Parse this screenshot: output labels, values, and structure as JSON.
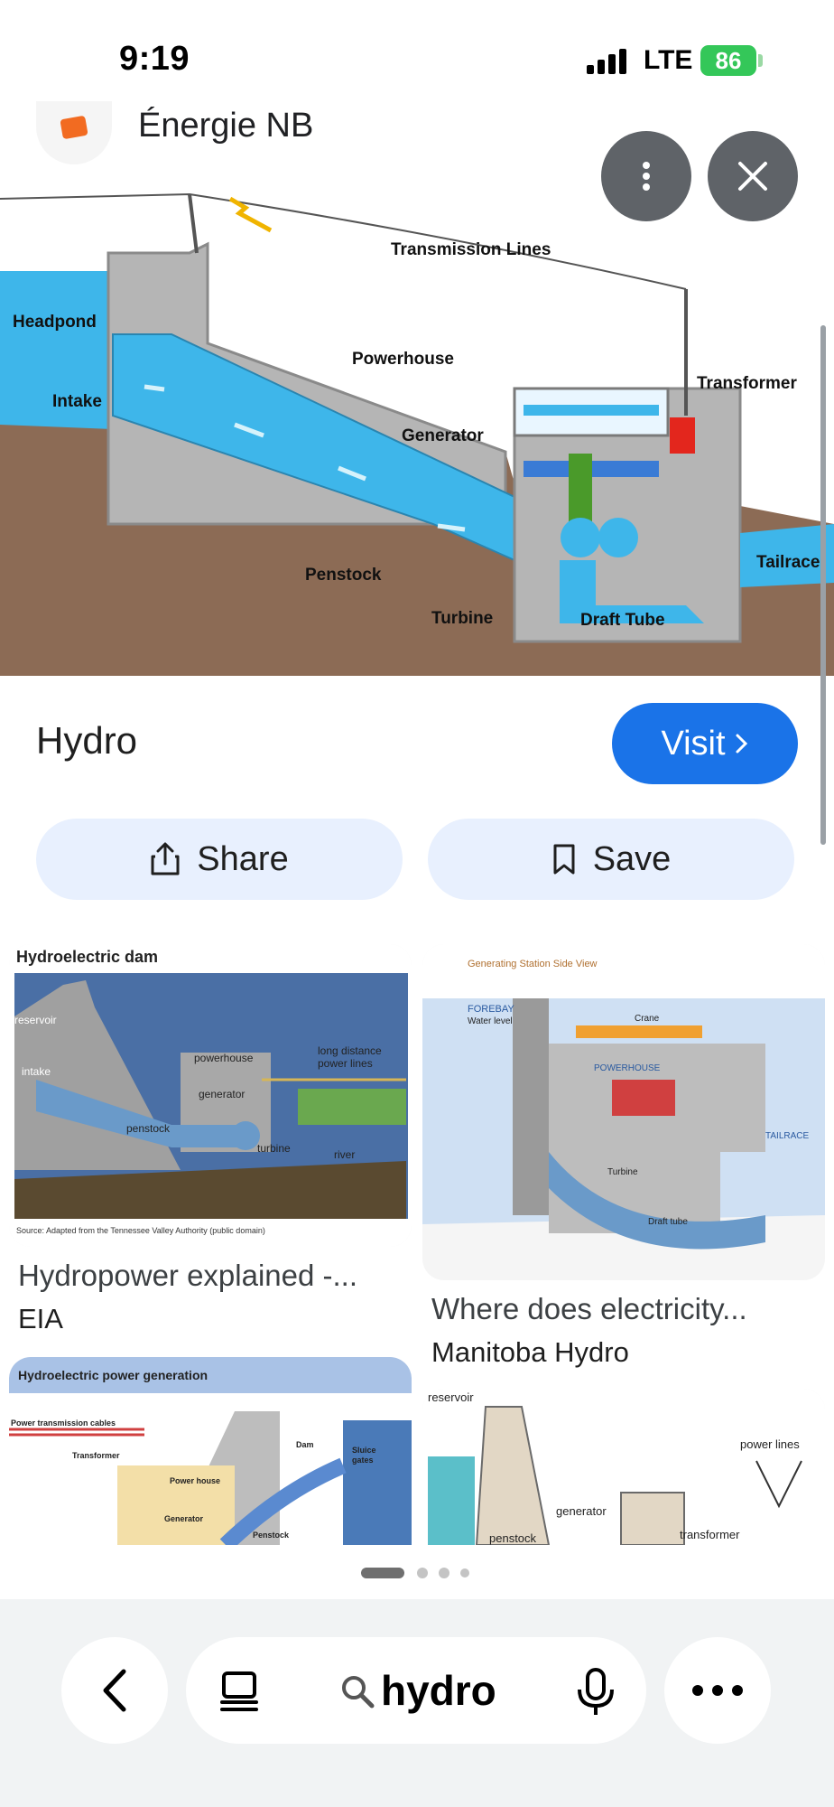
{
  "status_bar": {
    "time": "9:19",
    "network": "LTE",
    "battery": "86"
  },
  "source": {
    "name": "Énergie NB"
  },
  "main_image": {
    "labels": {
      "transmission": "Transmission Lines",
      "headpond": "Headpond",
      "intake": "Intake",
      "powerhouse": "Powerhouse",
      "transformer": "Transformer",
      "generator": "Generator",
      "penstock": "Penstock",
      "turbine": "Turbine",
      "draft_tube": "Draft Tube",
      "tailrace": "Tailrace"
    }
  },
  "result": {
    "title": "Hydro",
    "visit_label": "Visit",
    "share_label": "Share",
    "save_label": "Save"
  },
  "related": [
    {
      "title": "Hydropower explained -...",
      "source": "EIA",
      "labels": {
        "heading": "Hydroelectric dam",
        "reservoir": "reservoir",
        "intake": "intake",
        "powerhouse": "powerhouse",
        "generator": "generator",
        "penstock": "penstock",
        "turbine": "turbine",
        "river": "river",
        "power_lines": "long distance",
        "power_lines2": "power lines",
        "credit": "Source: Adapted from the Tennessee Valley Authority (public domain)"
      }
    },
    {
      "title": "Where does electricity...",
      "source": "Manitoba Hydro",
      "labels": {
        "heading": "Generating Station Side View",
        "forebay": "FOREBAY",
        "water_level": "Water level",
        "crane": "Crane",
        "powerhouse": "POWERHOUSE",
        "turbine": "Turbine",
        "draft_tube": "Draft tube",
        "tailrace": "TAILRACE"
      }
    },
    {
      "labels": {
        "heading": "Hydroelectric power generation",
        "cables": "Power transmission cables",
        "transformer": "Transformer",
        "dam": "Dam",
        "sluice": "Sluice",
        "gates": "gates",
        "power_house": "Power house",
        "generator": "Generator",
        "penstock": "Penstock"
      }
    },
    {
      "labels": {
        "reservoir": "reservoir",
        "power_lines": "power lines",
        "generator": "generator",
        "transformer": "transformer",
        "penstock": "penstock"
      }
    }
  ],
  "toolbar": {
    "query": "hydro"
  },
  "icons": {
    "more": "more-vertical-icon",
    "close": "close-icon",
    "share": "share-icon",
    "save": "bookmark-icon",
    "back": "chevron-left-icon",
    "tabs": "tabs-icon",
    "search": "search-icon",
    "mic": "mic-icon",
    "overflow": "more-horizontal-icon"
  },
  "colors": {
    "accent": "#1a73e8",
    "pill": "#e8f0fe",
    "battery": "#34c759",
    "water": "#3eb6ea",
    "ground": "#8c6b55"
  }
}
